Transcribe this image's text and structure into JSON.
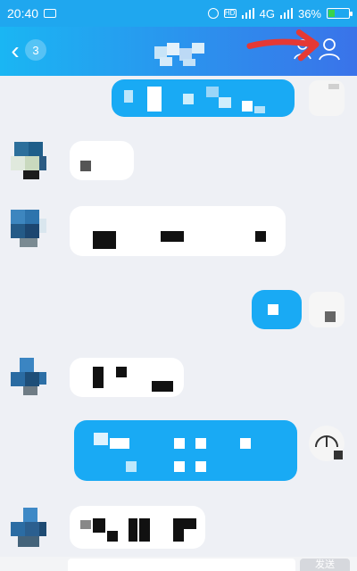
{
  "status_bar": {
    "time": "20:40",
    "network": "4G",
    "battery_percent": 36,
    "battery_label": "36%"
  },
  "nav": {
    "unread_count": "3"
  },
  "colors": {
    "status_bar": "#1fa7ef",
    "nav_left": "#1ab6f3",
    "nav_right": "#3a73e9",
    "chat_bg": "#eef0f5",
    "bubble_outgoing": "#19aaf4",
    "bubble_incoming": "#ffffff",
    "annotation_arrow": "#e53935"
  },
  "icons": {
    "back": "chevron-left-icon",
    "profile": "person-outline-icon",
    "annotation": "red-arrow-annotation"
  },
  "composer": {
    "send_label": "发送"
  }
}
